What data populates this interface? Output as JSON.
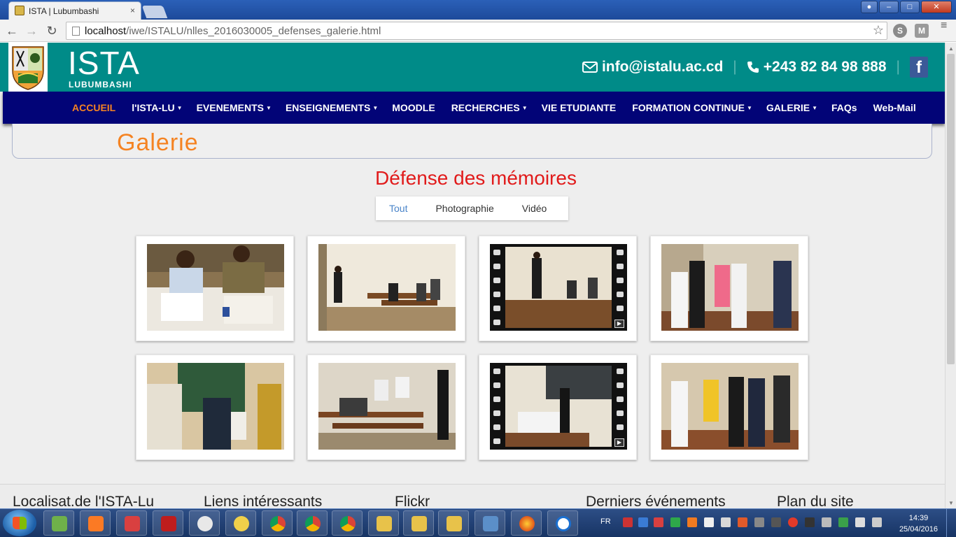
{
  "browser": {
    "tab_title": "ISTA | Lubumbashi",
    "tab_close": "×",
    "url_host": "localhost",
    "url_path": "/iwe/ISTALU/nlles_2016030005_defenses_galerie.html",
    "back": "←",
    "forward": "→",
    "reload": "↻",
    "star": "☆",
    "ext_s": "S",
    "ext_m": "M",
    "menu": "≡",
    "win_minimize": "–",
    "win_maximize": "□",
    "win_close": "✕",
    "win_user": "●"
  },
  "header": {
    "brand": "ISTA",
    "brand_sub": "LUBUMBASHI",
    "email": "info@istalu.ac.cd",
    "phone": "+243 82 84 98 888",
    "facebook": "f",
    "separator": "|"
  },
  "nav": {
    "items": [
      {
        "label": "ACCUEIL",
        "caret": ""
      },
      {
        "label": "l'ISTA-LU",
        "caret": "▼"
      },
      {
        "label": "EVENEMENTS",
        "caret": "▼"
      },
      {
        "label": "ENSEIGNEMENTS",
        "caret": "▼"
      },
      {
        "label": "MOODLE",
        "caret": ""
      },
      {
        "label": "RECHERCHES",
        "caret": "▼"
      },
      {
        "label": "VIE ETUDIANTE",
        "caret": ""
      },
      {
        "label": "FORMATION CONTINUE",
        "caret": "▼"
      },
      {
        "label": "GALERIE",
        "caret": "▼"
      },
      {
        "label": "FAQs",
        "caret": ""
      },
      {
        "label": "Web-Mail",
        "caret": ""
      }
    ]
  },
  "page": {
    "title": "Galerie",
    "heading": "Défense des mémoires"
  },
  "filters": [
    {
      "label": "Tout"
    },
    {
      "label": "Photographie"
    },
    {
      "label": "Vidéo"
    }
  ],
  "gallery": [
    {
      "type": "photo",
      "scene": "two-men-at-desk"
    },
    {
      "type": "photo",
      "scene": "classroom-desks"
    },
    {
      "type": "video",
      "scene": "standing-presenter"
    },
    {
      "type": "photo",
      "scene": "group-standing"
    },
    {
      "type": "photo",
      "scene": "student-with-microphone"
    },
    {
      "type": "photo",
      "scene": "students-writing"
    },
    {
      "type": "video",
      "scene": "blackboard-room"
    },
    {
      "type": "photo",
      "scene": "group-outdoors"
    }
  ],
  "footer": {
    "columns": [
      "Localisat.de l'ISTA-Lu",
      "Liens intéressants",
      "Flickr",
      "Derniers événements",
      "Plan du site"
    ]
  },
  "taskbar": {
    "language": "FR",
    "time": "14:39",
    "date": "25/04/2016"
  },
  "colors": {
    "header_teal": "#008b88",
    "nav_navy": "#020477",
    "accent_orange": "#f58322",
    "heading_red": "#e11b1b",
    "filter_active_blue": "#4a84c9"
  }
}
